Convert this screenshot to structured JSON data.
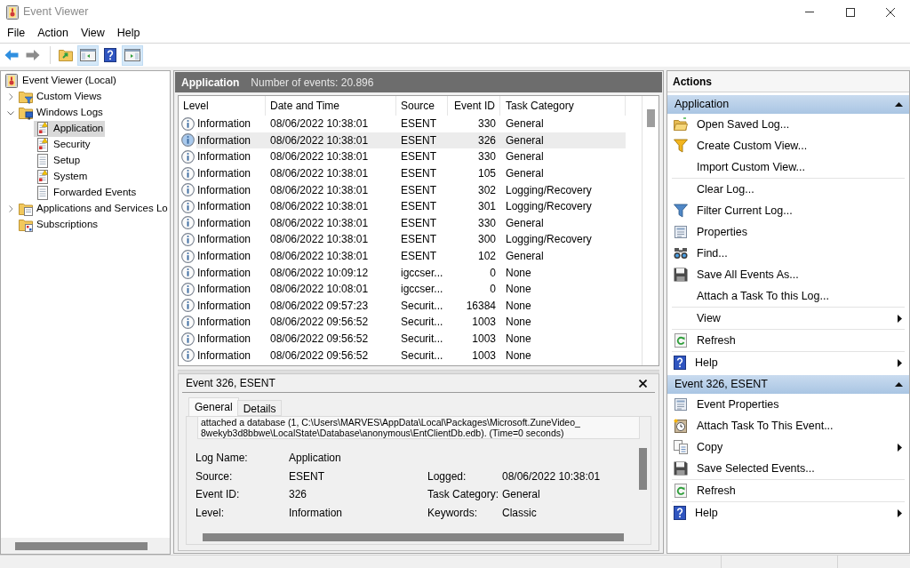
{
  "window": {
    "title": "Event Viewer"
  },
  "menu": [
    "File",
    "Action",
    "View",
    "Help"
  ],
  "toolbar": {
    "groups": [
      [
        {
          "kind": "back",
          "on": false,
          "disabled": false
        },
        {
          "kind": "forward",
          "on": false,
          "disabled": true
        }
      ],
      [
        {
          "kind": "up-folder",
          "on": false
        },
        {
          "kind": "console-tree",
          "on": true
        },
        {
          "kind": "help",
          "on": false
        },
        {
          "kind": "action-pane",
          "on": true
        }
      ]
    ]
  },
  "tree": [
    {
      "label": "Event Viewer (Local)",
      "kind": "viewer",
      "selected": false,
      "children": [
        {
          "label": "Custom Views",
          "kind": "folder-filter",
          "expanded": false,
          "selected": false
        },
        {
          "label": "Windows Logs",
          "kind": "folder-computer",
          "expanded": true,
          "selected": false,
          "children": [
            {
              "label": "Application",
              "kind": "log-alert",
              "selected": true
            },
            {
              "label": "Security",
              "kind": "log-alert",
              "selected": false
            },
            {
              "label": "Setup",
              "kind": "log",
              "selected": false
            },
            {
              "label": "System",
              "kind": "log-alert",
              "selected": false
            },
            {
              "label": "Forwarded Events",
              "kind": "log",
              "selected": false
            }
          ]
        },
        {
          "label": "Applications and Services Lo",
          "kind": "folder-doc",
          "expanded": false,
          "selected": false
        },
        {
          "label": "Subscriptions",
          "kind": "folder-sub",
          "selected": false
        }
      ]
    }
  ],
  "log_header": {
    "title": "Application",
    "count": "Number of events: 20.896"
  },
  "events_table": {
    "columns": [
      "Level",
      "Date and Time",
      "Source",
      "Event ID",
      "Task Category"
    ],
    "rows": [
      {
        "level": "Information",
        "date_time": "08/06/2022 10:38:01",
        "source": "ESENT",
        "event_id": "330",
        "task_category": "General",
        "selected": false
      },
      {
        "level": "Information",
        "date_time": "08/06/2022 10:38:01",
        "source": "ESENT",
        "event_id": "326",
        "task_category": "General",
        "selected": true
      },
      {
        "level": "Information",
        "date_time": "08/06/2022 10:38:01",
        "source": "ESENT",
        "event_id": "330",
        "task_category": "General",
        "selected": false
      },
      {
        "level": "Information",
        "date_time": "08/06/2022 10:38:01",
        "source": "ESENT",
        "event_id": "105",
        "task_category": "General",
        "selected": false
      },
      {
        "level": "Information",
        "date_time": "08/06/2022 10:38:01",
        "source": "ESENT",
        "event_id": "302",
        "task_category": "Logging/Recovery",
        "selected": false
      },
      {
        "level": "Information",
        "date_time": "08/06/2022 10:38:01",
        "source": "ESENT",
        "event_id": "301",
        "task_category": "Logging/Recovery",
        "selected": false
      },
      {
        "level": "Information",
        "date_time": "08/06/2022 10:38:01",
        "source": "ESENT",
        "event_id": "330",
        "task_category": "General",
        "selected": false
      },
      {
        "level": "Information",
        "date_time": "08/06/2022 10:38:01",
        "source": "ESENT",
        "event_id": "300",
        "task_category": "Logging/Recovery",
        "selected": false
      },
      {
        "level": "Information",
        "date_time": "08/06/2022 10:38:01",
        "source": "ESENT",
        "event_id": "102",
        "task_category": "General",
        "selected": false
      },
      {
        "level": "Information",
        "date_time": "08/06/2022 10:09:12",
        "source": "igccser...",
        "event_id": "0",
        "task_category": "None",
        "selected": false
      },
      {
        "level": "Information",
        "date_time": "08/06/2022 10:08:01",
        "source": "igccser...",
        "event_id": "0",
        "task_category": "None",
        "selected": false
      },
      {
        "level": "Information",
        "date_time": "08/06/2022 09:57:23",
        "source": "Securit...",
        "event_id": "16384",
        "task_category": "None",
        "selected": false
      },
      {
        "level": "Information",
        "date_time": "08/06/2022 09:56:52",
        "source": "Securit...",
        "event_id": "1003",
        "task_category": "None",
        "selected": false
      },
      {
        "level": "Information",
        "date_time": "08/06/2022 09:56:52",
        "source": "Securit...",
        "event_id": "1003",
        "task_category": "None",
        "selected": false
      },
      {
        "level": "Information",
        "date_time": "08/06/2022 09:56:52",
        "source": "Securit...",
        "event_id": "1003",
        "task_category": "None",
        "selected": false
      }
    ]
  },
  "event_detail": {
    "title": "Event 326, ESENT",
    "tabs": [
      {
        "label": "General",
        "selected": true
      },
      {
        "label": "Details",
        "selected": false
      }
    ],
    "description": [
      "attached a database (1, C:\\Users\\MARVES\\AppData\\Local\\Packages\\Microsoft.ZuneVideo_",
      "8wekyb3d8bbwe\\LocalState\\Database\\anonymous\\EntClientDb.edb). (Time=0 seconds)"
    ],
    "fields": [
      [
        {
          "label": "Log Name:",
          "value": "Application"
        }
      ],
      [
        {
          "label": "Source:",
          "value": "ESENT"
        },
        {
          "label": "Logged:",
          "value": "08/06/2022 10:38:01"
        }
      ],
      [
        {
          "label": "Event ID:",
          "value": "326"
        },
        {
          "label": "Task Category:",
          "value": "General"
        }
      ],
      [
        {
          "label": "Level:",
          "value": "Information"
        },
        {
          "label": "Keywords:",
          "value": "Classic"
        }
      ]
    ]
  },
  "actions": {
    "title": "Actions",
    "sections": [
      {
        "title": "Application",
        "expanded": true,
        "groups": [
          [
            {
              "label": "Open Saved Log...",
              "kind": "open-log",
              "submenu": false
            },
            {
              "label": "Create Custom View...",
              "kind": "create-view",
              "submenu": false
            },
            {
              "label": "Import Custom View...",
              "kind": "plain",
              "submenu": false
            }
          ],
          [
            {
              "label": "Clear Log...",
              "kind": "plain",
              "submenu": false
            },
            {
              "label": "Filter Current Log...",
              "kind": "filter",
              "submenu": false
            },
            {
              "label": "Properties",
              "kind": "properties",
              "submenu": false
            },
            {
              "label": "Find...",
              "kind": "find",
              "submenu": false
            },
            {
              "label": "Save All Events As...",
              "kind": "save",
              "submenu": false
            },
            {
              "label": "Attach a Task To this Log...",
              "kind": "plain",
              "submenu": false
            }
          ],
          [
            {
              "label": "View",
              "kind": "plain",
              "submenu": true
            }
          ],
          [
            {
              "label": "Refresh",
              "kind": "refresh",
              "submenu": false
            }
          ],
          [
            {
              "label": "Help",
              "kind": "help",
              "submenu": true
            }
          ]
        ]
      },
      {
        "title": "Event 326, ESENT",
        "expanded": true,
        "groups": [
          [
            {
              "label": "Event Properties",
              "kind": "properties",
              "submenu": false
            },
            {
              "label": "Attach Task To This Event...",
              "kind": "attach-task",
              "submenu": false
            },
            {
              "label": "Copy",
              "kind": "copy",
              "submenu": true
            },
            {
              "label": "Save Selected Events...",
              "kind": "save",
              "submenu": false
            }
          ],
          [
            {
              "label": "Refresh",
              "kind": "refresh",
              "submenu": false
            }
          ],
          [
            {
              "label": "Help",
              "kind": "help",
              "submenu": true
            }
          ]
        ]
      }
    ]
  }
}
